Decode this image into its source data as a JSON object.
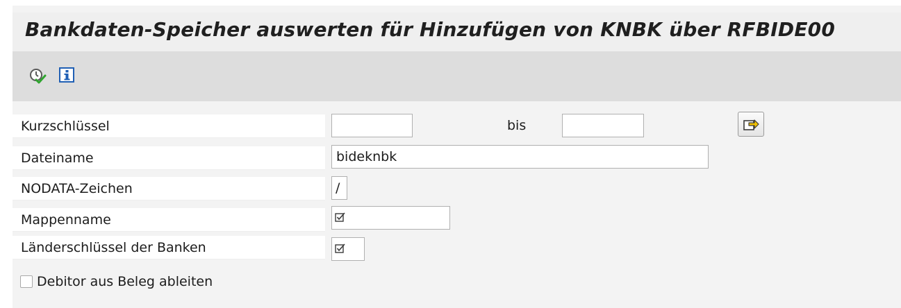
{
  "title": "Bankdaten-Speicher auswerten für Hinzufügen von KNBK über RFBIDE00",
  "toolbar": {
    "execute_icon": "execute-clock-icon",
    "info_icon": "info-icon"
  },
  "fields": {
    "kurzschluessel": {
      "label": "Kurzschlüssel",
      "value_from": "",
      "to_label": "bis",
      "value_to": ""
    },
    "dateiname": {
      "label": "Dateiname",
      "value": "bideknbk"
    },
    "nodata": {
      "label": "NODATA-Zeichen",
      "value": "/"
    },
    "mappenname": {
      "label": "Mappenname",
      "value_icon": "required-entry-icon"
    },
    "laenderschluessel": {
      "label": "Länderschlüssel der Banken",
      "value_icon": "required-entry-icon"
    }
  },
  "checkbox": {
    "label": "Debitor aus Beleg ableiten",
    "checked": false
  },
  "colors": {
    "title_bar": "#efefef",
    "toolbar": "#dddddd",
    "background": "#f3f3f3",
    "input_border": "#b0b0b0",
    "info_blue": "#1f5fb4",
    "multi_arrow": "#f2c200"
  }
}
